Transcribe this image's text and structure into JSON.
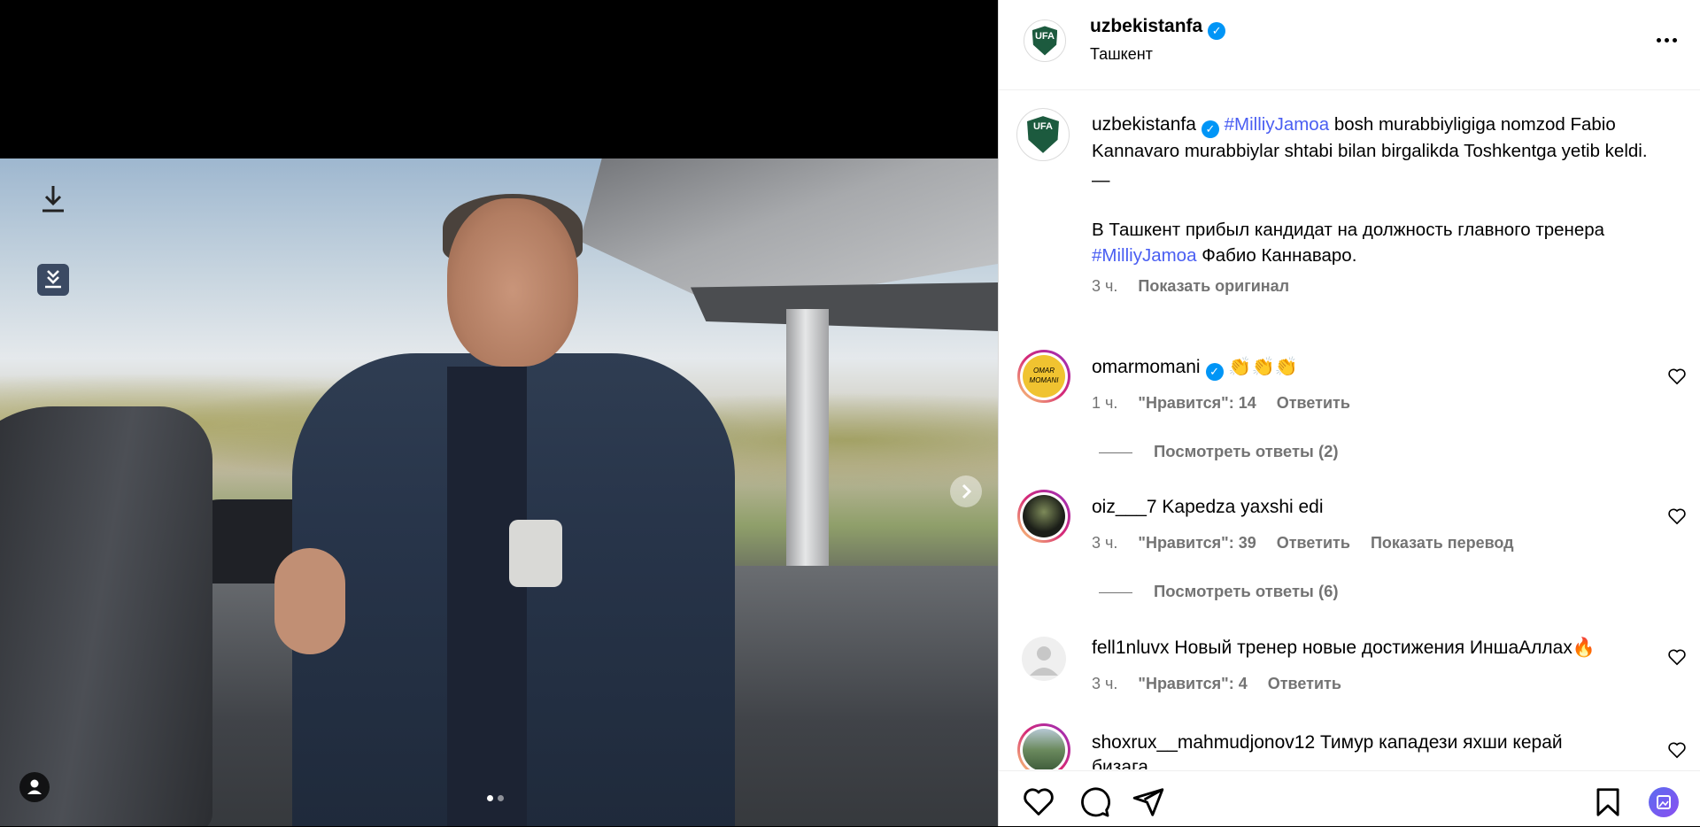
{
  "post": {
    "account": "uzbekistanfa",
    "location": "Ташкент",
    "avatar_text": "UFA",
    "caption_line1_pre": "",
    "caption_hashtag": "#MilliyJamoa",
    "caption_line1_post": "bosh murabbiyligiga nomzod Fabio Kannavaro murabbiylar shtabi bilan birgalikda Toshkentga yetib keldi.",
    "caption_dash": "—",
    "caption_ru_pre": "В Ташкент прибыл кандидат на должность главного тренера",
    "caption_ru_hashtag": "#MilliyJamoa",
    "caption_ru_post": "Фабио Каннаваро.",
    "time": "3 ч.",
    "show_original": "Показать оригинал"
  },
  "comments": [
    {
      "user": "omarmomani",
      "verified": true,
      "text": "👏👏👏",
      "time": "1 ч.",
      "likes": "\"Нравится\": 14",
      "reply": "Ответить",
      "extra": "",
      "avatar_text": "OMAR MOMANI"
    },
    {
      "user": "oiz___7",
      "verified": false,
      "text": "Kapedza yaxshi edi",
      "time": "3 ч.",
      "likes": "\"Нравится\": 39",
      "reply": "Ответить",
      "extra": "Показать перевод",
      "avatar_text": ""
    },
    {
      "user": "fell1nluvx",
      "verified": false,
      "text": "Новый тренер новые достижения ИншаАллах🔥",
      "time": "3 ч.",
      "likes": "\"Нравится\": 4",
      "reply": "Ответить",
      "extra": "",
      "avatar_text": ""
    },
    {
      "user": "shoxrux__mahmudjonov12",
      "verified": false,
      "text": "Тимур кападези яхши керай",
      "text2": "бизага",
      "avatar_text": ""
    }
  ],
  "view_replies": [
    "Посмотреть ответы (2)",
    "Посмотреть ответы (6)"
  ],
  "icons": {
    "download": "download-icon",
    "download_box": "download-box-icon",
    "user_tag": "user-tag-icon",
    "next": "chevron-right-icon",
    "more": "more-icon",
    "like": "heart-icon",
    "comment": "comment-icon",
    "share": "send-icon",
    "save": "bookmark-icon"
  },
  "colors": {
    "verified": "#0095f6",
    "hashtag": "#4a5ef2",
    "meta": "#737373"
  },
  "carousel": {
    "total": 2,
    "current": 1
  }
}
